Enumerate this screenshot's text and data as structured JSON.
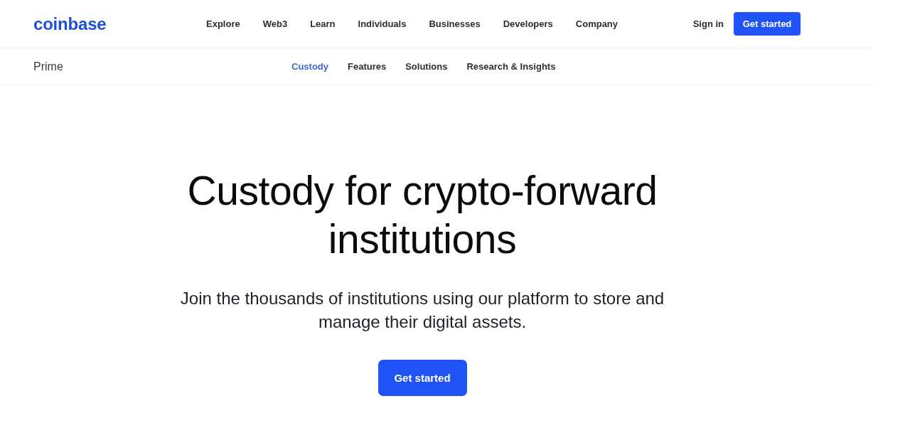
{
  "header": {
    "logo": "coinbase",
    "nav": [
      "Explore",
      "Web3",
      "Learn",
      "Individuals",
      "Businesses",
      "Developers",
      "Company"
    ],
    "sign_in": "Sign in",
    "cta": "Get started"
  },
  "subnav": {
    "title": "Prime",
    "tabs": [
      {
        "label": "Custody",
        "selected": true
      },
      {
        "label": "Features",
        "selected": false
      },
      {
        "label": "Solutions",
        "selected": false
      },
      {
        "label": "Research & Insights",
        "selected": false
      }
    ]
  },
  "hero": {
    "headline": "Custody for crypto-forward institutions",
    "subtitle": "Join the thousands of institutions using our platform to store and manage their digital assets.",
    "cta": "Get started"
  }
}
